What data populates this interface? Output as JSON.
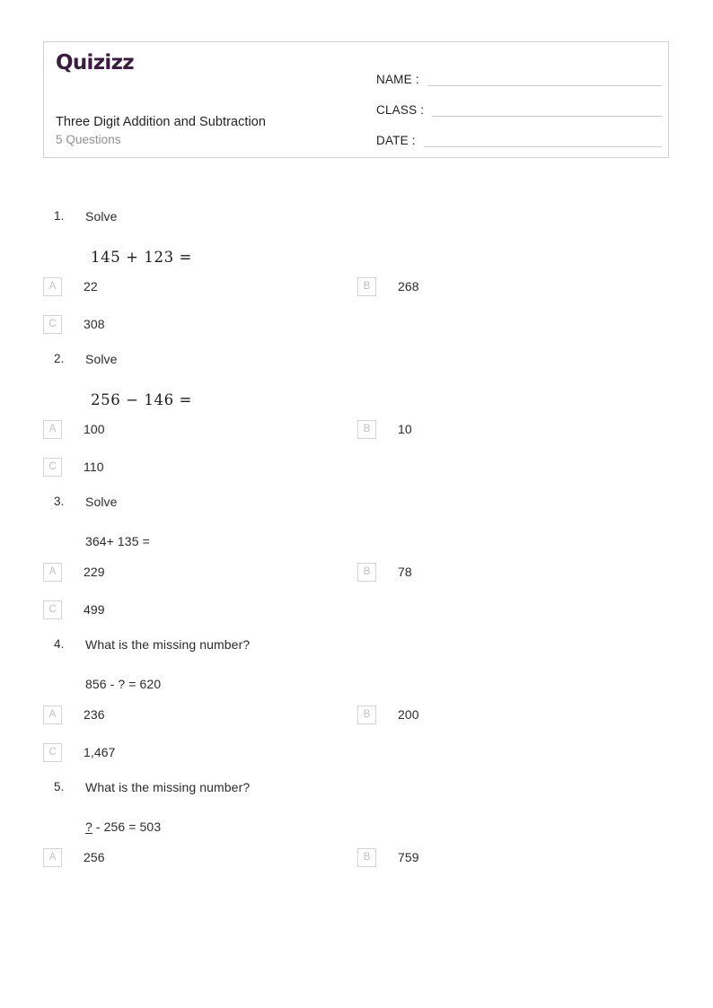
{
  "header": {
    "logo_text": "Quizizz",
    "title": "Three Digit Addition and Subtraction",
    "question_count_label": "5 Questions",
    "fields": [
      {
        "label": "NAME :",
        "value": ""
      },
      {
        "label": "CLASS :",
        "value": ""
      },
      {
        "label": "DATE  :",
        "value": ""
      }
    ]
  },
  "questions": [
    {
      "number": "1.",
      "prompt": "Solve",
      "expression": "145 + 123 =",
      "expression_style": "serif",
      "options": [
        {
          "letter": "A",
          "text": "22"
        },
        {
          "letter": "B",
          "text": "268"
        },
        {
          "letter": "C",
          "text": "308"
        }
      ]
    },
    {
      "number": "2.",
      "prompt": "Solve",
      "expression": "256 − 146 =",
      "expression_style": "serif",
      "options": [
        {
          "letter": "A",
          "text": "100"
        },
        {
          "letter": "B",
          "text": "10"
        },
        {
          "letter": "C",
          "text": "110"
        }
      ]
    },
    {
      "number": "3.",
      "prompt": "Solve",
      "expression": "364+ 135 =",
      "expression_style": "sans",
      "options": [
        {
          "letter": "A",
          "text": "229"
        },
        {
          "letter": "B",
          "text": "78"
        },
        {
          "letter": "C",
          "text": "499"
        }
      ]
    },
    {
      "number": "4.",
      "prompt": "What is the missing number?",
      "expression": "856 - ? = 620",
      "expression_style": "sans",
      "options": [
        {
          "letter": "A",
          "text": "236"
        },
        {
          "letter": "B",
          "text": "200"
        },
        {
          "letter": "C",
          "text": "1,467"
        }
      ]
    },
    {
      "number": "5.",
      "prompt": "What is the missing number?",
      "expression_prefix": "?",
      "expression_suffix": " - 256 = 503",
      "expression_style": "sans-underlined",
      "options": [
        {
          "letter": "A",
          "text": "256"
        },
        {
          "letter": "B",
          "text": "759"
        }
      ]
    }
  ],
  "colors": {
    "logo": "#3b1b3f",
    "title": "#231f20",
    "subtitle": "#8f8f8f",
    "body_text": "#2b2b2b",
    "option_letter": "#c2c2c2",
    "border": "#cfcfcf"
  }
}
